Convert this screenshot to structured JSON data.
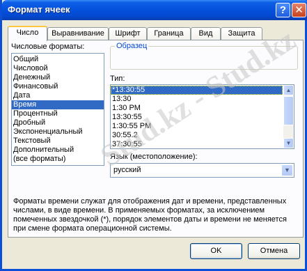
{
  "window": {
    "title": "Формат ячеек"
  },
  "titlebar": {
    "help_glyph": "?",
    "close_glyph": "✕"
  },
  "tabs": [
    {
      "label": "Число",
      "active": true
    },
    {
      "label": "Выравнивание"
    },
    {
      "label": "Шрифт"
    },
    {
      "label": "Граница"
    },
    {
      "label": "Вид"
    },
    {
      "label": "Защита"
    }
  ],
  "categories": {
    "label": "Числовые форматы:",
    "items": [
      "Общий",
      "Числовой",
      "Денежный",
      "Финансовый",
      "Дата",
      "Время",
      "Процентный",
      "Дробный",
      "Экспоненциальный",
      "Текстовый",
      "Дополнительный",
      "(все форматы)"
    ],
    "selected": "Время"
  },
  "sample": {
    "legend": "Образец"
  },
  "type": {
    "label": "Тип:",
    "items": [
      "*13:30:55",
      "13:30",
      "1:30 PM",
      "13:30:55",
      "1:30:55 PM",
      "30:55.2",
      "37:30:55"
    ],
    "selected": "*13:30:55"
  },
  "locale": {
    "label": "Язык (местоположение):",
    "value": "русский"
  },
  "description": "Форматы времени служат для отображения дат и времени, представленных числами, в виде времени. В применяемых форматах, за исключением помеченных звездочкой (*), порядок элементов даты и времени не меняется при смене формата операционной системы.",
  "buttons": {
    "ok": "OK",
    "cancel": "Отмена"
  },
  "watermark": "Stud.kz - Stud.kz",
  "icons": {
    "scroll_up": "▲",
    "scroll_down": "▼",
    "dropdown": "▼"
  },
  "colors": {
    "titlebar": "#0553de",
    "selection": "#316ac5",
    "tab_highlight": "#ffc83c",
    "dialog_bg": "#ece9d8"
  }
}
